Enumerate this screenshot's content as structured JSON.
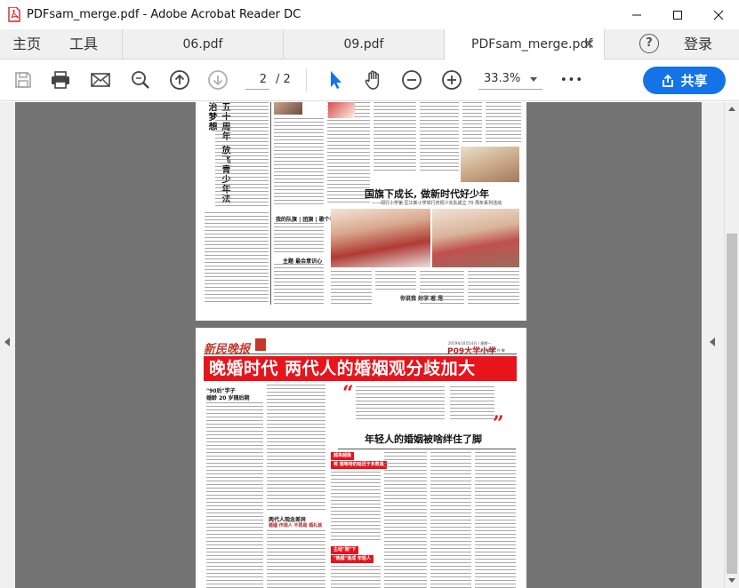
{
  "window": {
    "title": "PDFsam_merge.pdf - Adobe Acrobat Reader DC"
  },
  "tabs": {
    "home": "主页",
    "tools": "工具",
    "documents": [
      {
        "label": "06.pdf",
        "active": false
      },
      {
        "label": "09.pdf",
        "active": false
      },
      {
        "label": "PDFsam_merge.pdf",
        "active": true
      }
    ],
    "close_glyph": "✕",
    "help_glyph": "?",
    "login": "登录"
  },
  "toolbar": {
    "current_page": "2",
    "page_separator": "/",
    "total_pages": "2",
    "zoom": "33.3%",
    "more_glyph": "•••",
    "share_label": "共享",
    "icons": [
      "save-icon",
      "print-icon",
      "email-icon",
      "search-icon",
      "prev-page-icon",
      "next-page-icon",
      "select-cursor-icon",
      "hand-icon",
      "zoom-out-icon",
      "zoom-in-icon",
      "more-icon",
      "share-icon"
    ],
    "accent_color": "#1473e6"
  },
  "page1": {
    "vertical_title": "五十周年 放飞青少年法治梦想",
    "headline": "国旗下成长, 做新时代好少年",
    "subline": "——闵行小学第 区江新小学举行庆祝少先队成立 70 周年系列活动",
    "small_heads": [
      "我的队旗 | 团旗 | 歌个礼",
      "主题 最会意识心",
      "你说我 好学 看 是"
    ]
  },
  "page2": {
    "masthead": "新民晚报",
    "date_line": "2019年10月14日 / 星期一",
    "section": "P09大学小学",
    "editor_line": "责任编辑: 许 敏",
    "banner": "晚婚时代  两代人的婚姻观分歧加大",
    "kicker": "\"90后\"学子",
    "kicker_sub": "婚龄 20 岁随后期",
    "sub_headline": "年轻人的婚姻被啥绊住了脚",
    "red_boxes": [
      "越来越晚",
      "将 婚等待的延迟于多数是",
      "主动\"剩\"下",
      "\"晚婚\"渐成 年轻人"
    ],
    "mini_head": "两代人观念差异",
    "mini_head_sub": "婚姻 作观人 不再是 婚礼就",
    "accent_color": "#e8141c"
  }
}
